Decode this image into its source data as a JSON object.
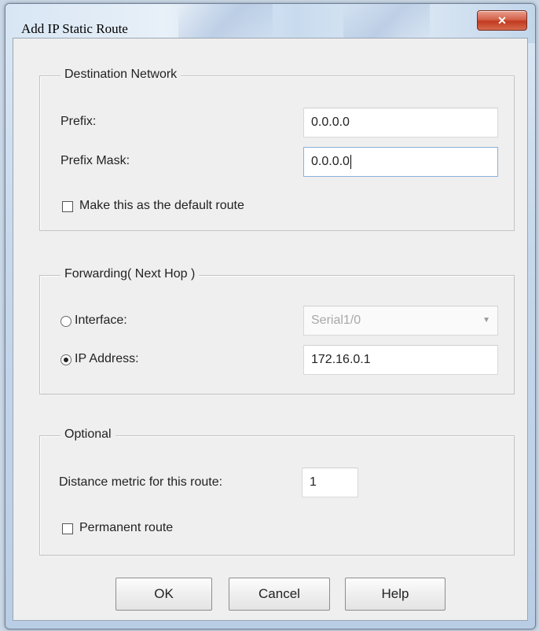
{
  "window": {
    "title": "Add IP Static Route",
    "close_glyph": "✕"
  },
  "destination_network": {
    "legend": "Destination Network",
    "prefix_label": "Prefix:",
    "prefix_value": "0.0.0.0",
    "mask_label": "Prefix Mask:",
    "mask_value": "0.0.0.0",
    "default_route_label": "Make this as the default route",
    "default_route_checked": false
  },
  "forwarding": {
    "legend": "Forwarding( Next Hop )",
    "interface_label": "Interface:",
    "interface_value": "Serial1/0",
    "interface_selected": false,
    "ip_label": "IP Address:",
    "ip_value": "172.16.0.1",
    "ip_selected": true
  },
  "optional": {
    "legend": "Optional",
    "distance_label": "Distance metric for this route:",
    "distance_value": "1",
    "permanent_label": "Permanent route",
    "permanent_checked": false
  },
  "buttons": {
    "ok": "OK",
    "cancel": "Cancel",
    "help": "Help"
  }
}
